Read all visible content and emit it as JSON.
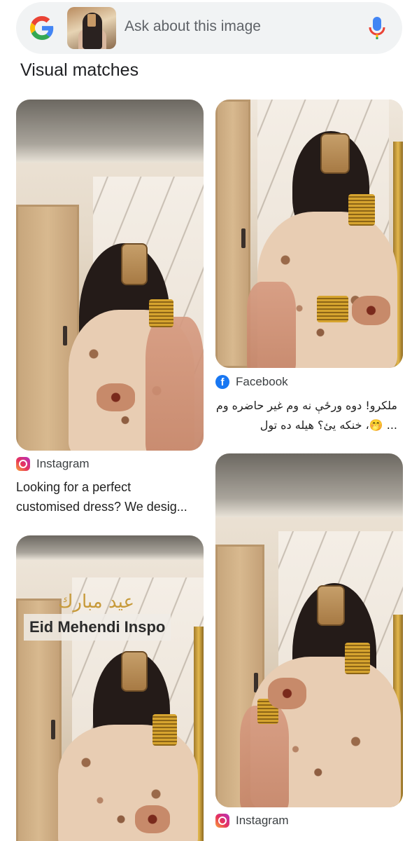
{
  "search": {
    "placeholder": "Ask about this image"
  },
  "section": {
    "title": "Visual matches"
  },
  "results": [
    {
      "source": "Instagram",
      "source_icon": "instagram-icon",
      "caption_line1": "Looking for a perfect",
      "caption_line2": "customised dress? We desig..."
    },
    {
      "source": "Facebook",
      "source_icon": "facebook-icon",
      "caption_line1": "ملکرو! دوه ورځې نه وم غیر حاضره وم",
      "caption_line2": "... 🤭، خنکه یئ؟ هیله ده تول"
    },
    {
      "overlay_arabic": "عيد مبارك",
      "overlay_label": "Eid Mehendi Inspo"
    },
    {
      "source": "Instagram",
      "source_icon": "instagram-icon"
    }
  ],
  "colors": {
    "google_blue": "#4285f4",
    "google_red": "#ea4335",
    "google_yellow": "#fbbc05",
    "google_green": "#34a853",
    "facebook": "#1877f2"
  }
}
